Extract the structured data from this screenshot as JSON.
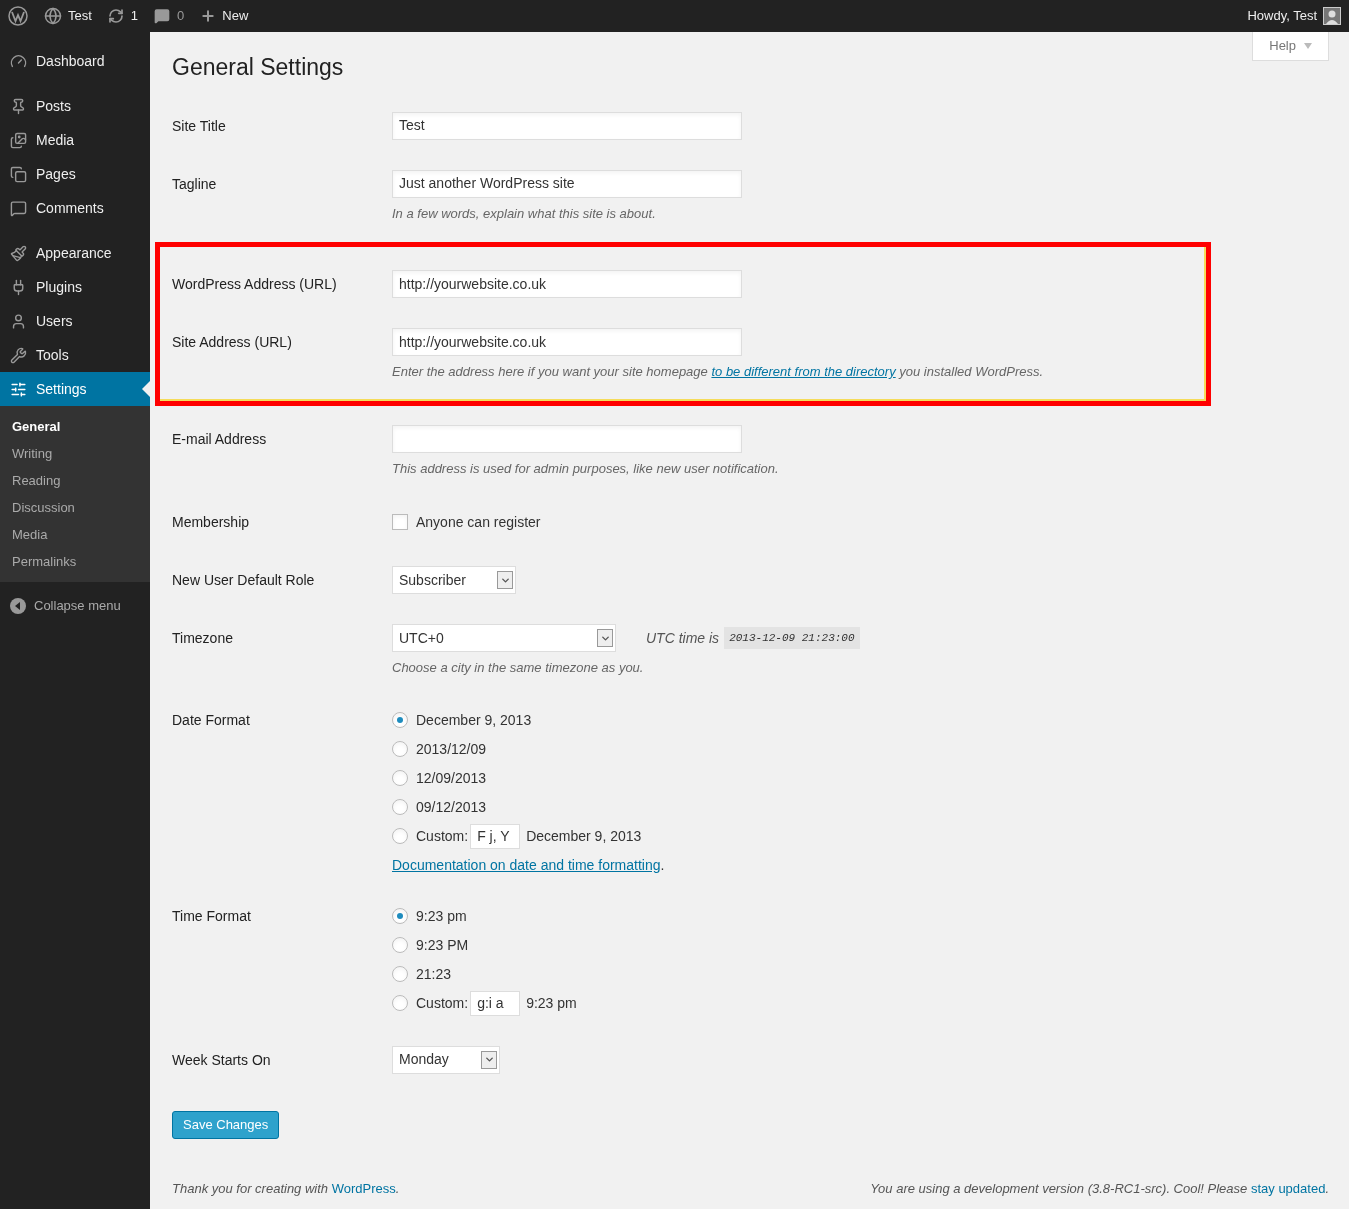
{
  "admin_bar": {
    "site": "Test",
    "updates": "1",
    "comments": "0",
    "new": "New",
    "greeting": "Howdy, Test"
  },
  "menu_groups": [
    {
      "items": [
        {
          "label": "Dashboard",
          "selected": false
        }
      ]
    },
    {
      "items": [
        {
          "label": "Posts",
          "selected": false
        },
        {
          "label": "Media",
          "selected": false
        },
        {
          "label": "Pages",
          "selected": false
        },
        {
          "label": "Comments",
          "selected": false
        }
      ]
    },
    {
      "items": [
        {
          "label": "Appearance",
          "selected": false
        },
        {
          "label": "Plugins",
          "selected": false
        },
        {
          "label": "Users",
          "selected": false
        },
        {
          "label": "Tools",
          "selected": false
        },
        {
          "label": "Settings",
          "selected": true,
          "children": [
            {
              "label": "General",
              "selected": true
            },
            {
              "label": "Writing",
              "selected": false
            },
            {
              "label": "Reading",
              "selected": false
            },
            {
              "label": "Discussion",
              "selected": false
            },
            {
              "label": "Media",
              "selected": false
            },
            {
              "label": "Permalinks",
              "selected": false
            }
          ]
        }
      ]
    }
  ],
  "collapse_menu": "Collapse menu",
  "help": "Help",
  "title": "General Settings",
  "rows": [
    {
      "kind": "text",
      "label": "Site Title",
      "value": "Test"
    },
    {
      "kind": "text",
      "label": "Tagline",
      "value": "Just another WordPress site",
      "description": {
        "text": "In a few words, explain what this site is about."
      }
    },
    {
      "kind": "highlight",
      "rows": [
        {
          "kind": "text",
          "label": "WordPress Address (URL)",
          "value": "http://yourwebsite.co.uk"
        },
        {
          "kind": "text",
          "label": "Site Address (URL)",
          "value": "http://yourwebsite.co.uk",
          "description": {
            "text": "Enter the address here if you want your site homepage ",
            "link": "to be different from the directory",
            "after": " you installed WordPress."
          }
        }
      ]
    },
    {
      "kind": "text",
      "label": "E-mail Address",
      "description": {
        "text": "This address is used for admin purposes, like new user notification."
      }
    },
    {
      "kind": "checkbox",
      "label": "Membership",
      "option": "Anyone can register",
      "checked": false
    },
    {
      "kind": "select",
      "label": "New User Default Role",
      "value": "Subscriber"
    },
    {
      "kind": "timezone",
      "label": "Timezone",
      "value": "UTC+0",
      "utc_label": "UTC time is",
      "utc_time": "2013-12-09 21:23:00",
      "description": {
        "text": "Choose a city in the same timezone as you."
      }
    },
    {
      "kind": "radios",
      "label": "Date Format",
      "options": [
        {
          "label": "December 9, 2013",
          "selected": true
        },
        {
          "label": "2013/12/09",
          "selected": false
        },
        {
          "label": "12/09/2013",
          "selected": false
        },
        {
          "label": "09/12/2013",
          "selected": false
        },
        {
          "label": "Custom:",
          "selected": false,
          "custom_value": "F j, Y",
          "preview": "December 9, 2013"
        }
      ],
      "doc_link": {
        "link": "Documentation on date and time formatting",
        "after": "."
      }
    },
    {
      "kind": "radios",
      "label": "Time Format",
      "options": [
        {
          "label": "9:23 pm",
          "selected": true
        },
        {
          "label": "9:23 PM",
          "selected": false
        },
        {
          "label": "21:23",
          "selected": false
        },
        {
          "label": "Custom:",
          "selected": false,
          "custom_value": "g:i a",
          "preview": "9:23 pm"
        }
      ]
    },
    {
      "kind": "select",
      "label": "Week Starts On",
      "value": "Monday"
    }
  ],
  "save_button": "Save Changes",
  "footer": {
    "left": {
      "text": "Thank you for creating with ",
      "link": "WordPress",
      "after": "."
    },
    "right": {
      "text": "You are using a development version (3.8-RC1-src). Cool! Please ",
      "link": "stay updated",
      "after": "."
    }
  }
}
